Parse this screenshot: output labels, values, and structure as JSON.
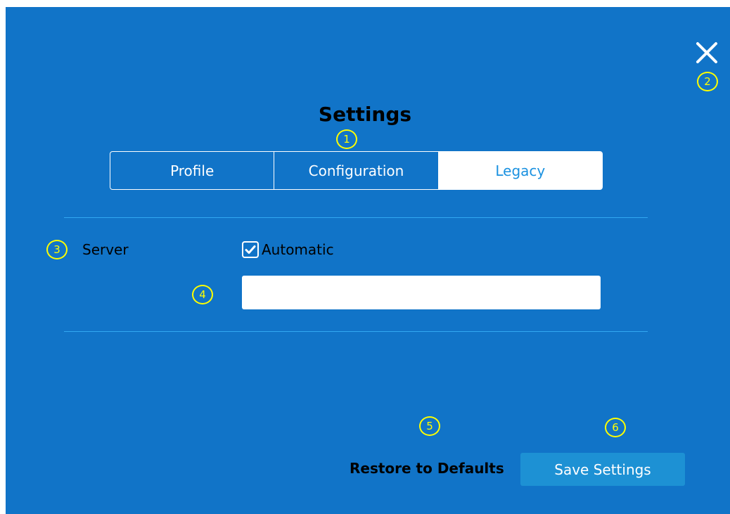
{
  "dialog": {
    "title": "Settings",
    "close_icon": "close-icon",
    "background_color": "#1174C8"
  },
  "tabs": [
    {
      "label": "Profile",
      "active": false
    },
    {
      "label": "Configuration",
      "active": false
    },
    {
      "label": "Legacy",
      "active": true
    }
  ],
  "server": {
    "label": "Server",
    "automatic_label": "Automatic",
    "automatic_checked": true,
    "input_value": "",
    "input_placeholder": ""
  },
  "footer": {
    "restore_label": "Restore to Defaults",
    "save_label": "Save Settings",
    "save_button_color": "#1D91D4"
  },
  "annotations": {
    "marker_color": "#FFFF00",
    "labels": [
      "1",
      "2",
      "3",
      "4",
      "5",
      "6"
    ]
  }
}
